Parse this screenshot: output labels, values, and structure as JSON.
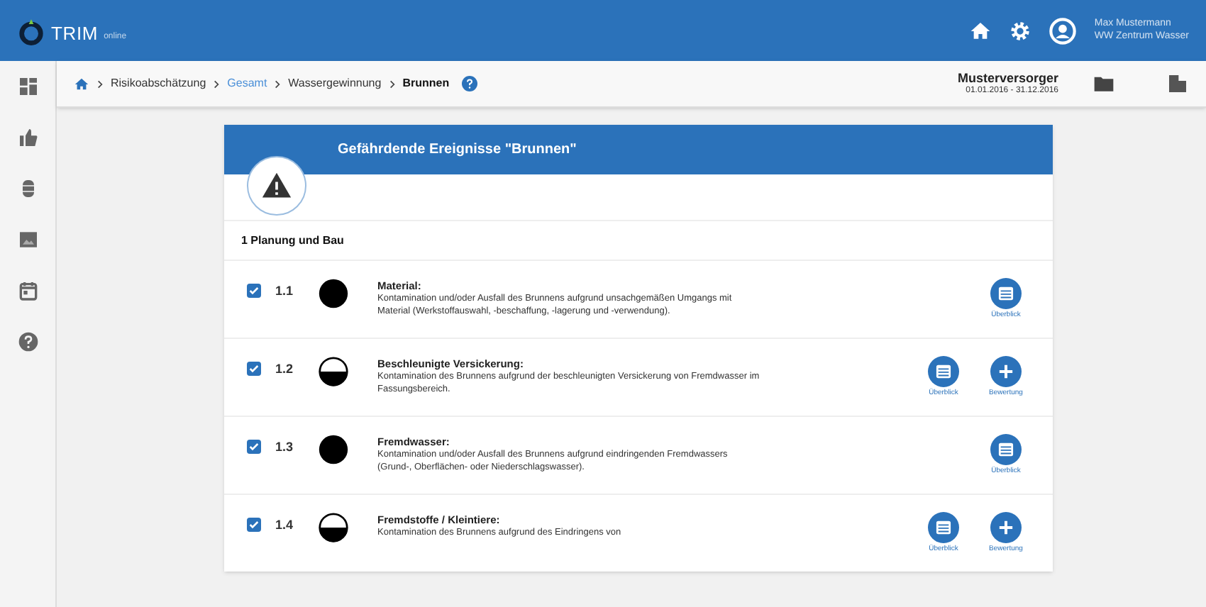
{
  "header": {
    "logo": "TRIM",
    "logo_suffix": "online",
    "user_name": "Max Mustermann",
    "user_org": "WW Zentrum Wasser"
  },
  "breadcrumb": {
    "items": [
      "Risikoabschätzung",
      "Gesamt",
      "Wassergewinnung",
      "Brunnen"
    ]
  },
  "supplier": {
    "name": "Musterversorger",
    "period": "01.01.2016 - 31.12.2016"
  },
  "card": {
    "title": "Gefährdende Ereignisse \"Brunnen\"",
    "section": "1 Planung und Bau",
    "events": [
      {
        "number": "1.1",
        "checked": true,
        "kind": "full",
        "title": "Material:",
        "description": "Kontamination und/oder Ausfall des Brunnens aufgrund unsachgemäßen Umgangs mit Material (Werkstoffauswahl, -beschaffung, -lagerung und -verwendung).",
        "actions": [
          {
            "kind": "overview",
            "label": "Überblick"
          }
        ]
      },
      {
        "number": "1.2",
        "checked": true,
        "kind": "half",
        "title": "Beschleunigte Versickerung:",
        "description": "Kontamination des Brunnens aufgrund der beschleunigten Versickerung von Fremdwasser im Fassungsbereich.",
        "actions": [
          {
            "kind": "overview",
            "label": "Überblick"
          },
          {
            "kind": "add",
            "label": "Bewertung"
          }
        ]
      },
      {
        "number": "1.3",
        "checked": true,
        "kind": "full",
        "title": "Fremdwasser:",
        "description": "Kontamination und/oder Ausfall des Brunnens aufgrund eindringenden Fremdwassers (Grund-, Oberflächen- oder Niederschlagswasser).",
        "actions": [
          {
            "kind": "overview",
            "label": "Überblick"
          }
        ]
      },
      {
        "number": "1.4",
        "checked": true,
        "kind": "half",
        "title": "Fremdstoffe / Kleintiere:",
        "description": "Kontamination des Brunnens aufgrund des Eindringens von",
        "actions": [
          {
            "kind": "overview",
            "label": "Überblick"
          },
          {
            "kind": "add",
            "label": "Bewertung"
          }
        ]
      }
    ]
  }
}
